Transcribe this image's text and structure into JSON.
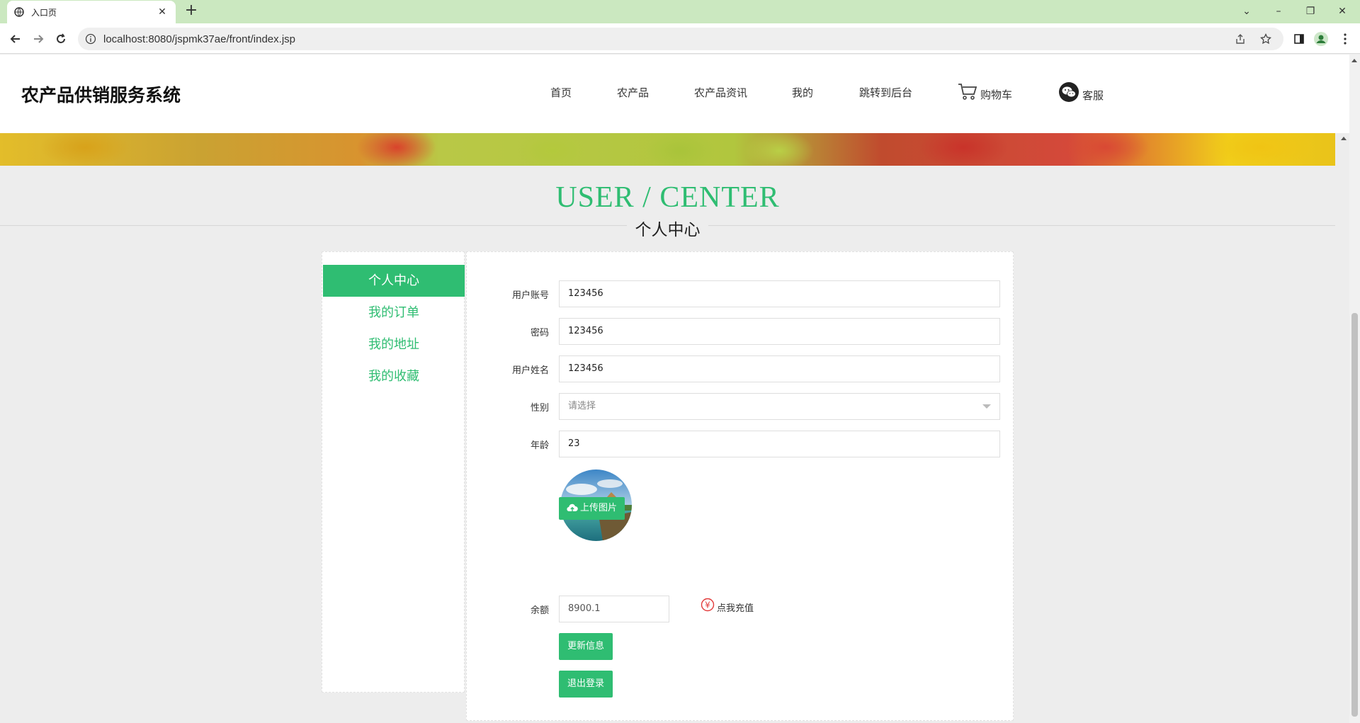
{
  "browser": {
    "tab_title": "入口页",
    "url": "localhost:8080/jspmk37ae/front/index.jsp"
  },
  "site": {
    "title": "农产品供销服务系统",
    "nav": [
      {
        "label": "首页"
      },
      {
        "label": "农产品"
      },
      {
        "label": "农产品资讯"
      },
      {
        "label": "我的"
      },
      {
        "label": "跳转到后台"
      },
      {
        "label": "购物车",
        "icon": "cart-icon"
      },
      {
        "label": "客服",
        "icon": "wechat-icon"
      }
    ]
  },
  "page": {
    "title_en": "USER / CENTER",
    "title_cn": "个人中心"
  },
  "sidebar": {
    "items": [
      {
        "label": "个人中心",
        "active": true
      },
      {
        "label": "我的订单"
      },
      {
        "label": "我的地址"
      },
      {
        "label": "我的收藏"
      }
    ]
  },
  "form": {
    "account": {
      "label": "用户账号",
      "value": "123456"
    },
    "password": {
      "label": "密码",
      "value": "123456"
    },
    "name": {
      "label": "用户姓名",
      "value": "123456"
    },
    "gender": {
      "label": "性别",
      "placeholder": "请选择"
    },
    "age": {
      "label": "年龄",
      "value": "23"
    },
    "upload_label": "上传图片",
    "balance": {
      "label": "余额",
      "value": "8900.1"
    },
    "recharge_label": "点我充值",
    "update_label": "更新信息",
    "logout_label": "退出登录"
  },
  "colors": {
    "accent": "#2fbd72",
    "tabbar": "#cbe8c0"
  }
}
